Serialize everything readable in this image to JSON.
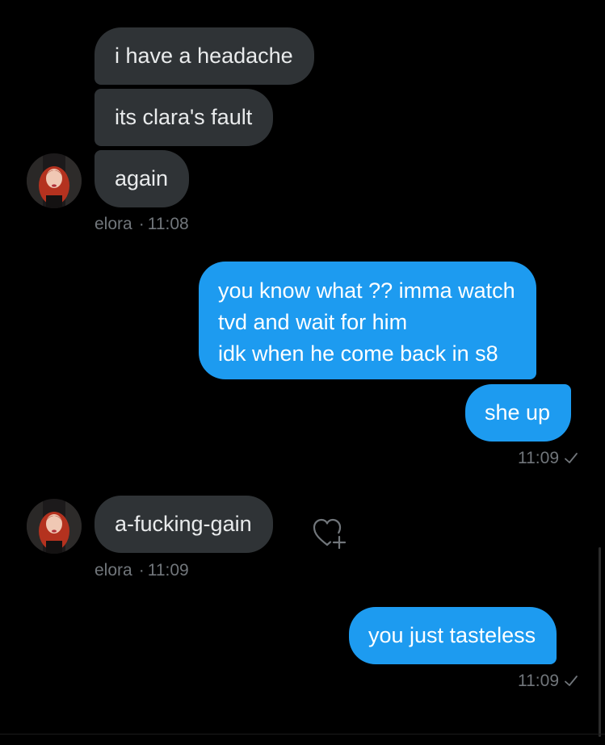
{
  "colors": {
    "background": "#000000",
    "received_bubble": "#2f3336",
    "sent_bubble": "#1d9bf0",
    "meta_text": "#71767b"
  },
  "conversation": {
    "group1": {
      "messages": [
        "i have a headache",
        "its clara's fault",
        "again"
      ],
      "sender": "elora",
      "time": "11:08"
    },
    "group2": {
      "messages": [
        {
          "lines": [
            "you know what ?? imma watch",
            "tvd and wait for him",
            "idk when he come back in s8"
          ]
        },
        "she up"
      ],
      "time": "11:09"
    },
    "group3": {
      "messages": [
        "a-fucking-gain"
      ],
      "sender": "elora",
      "time": "11:09",
      "reaction_icon": "heart-plus-icon"
    },
    "group4": {
      "messages": [
        "you just tasteless"
      ],
      "time": "11:09"
    }
  }
}
